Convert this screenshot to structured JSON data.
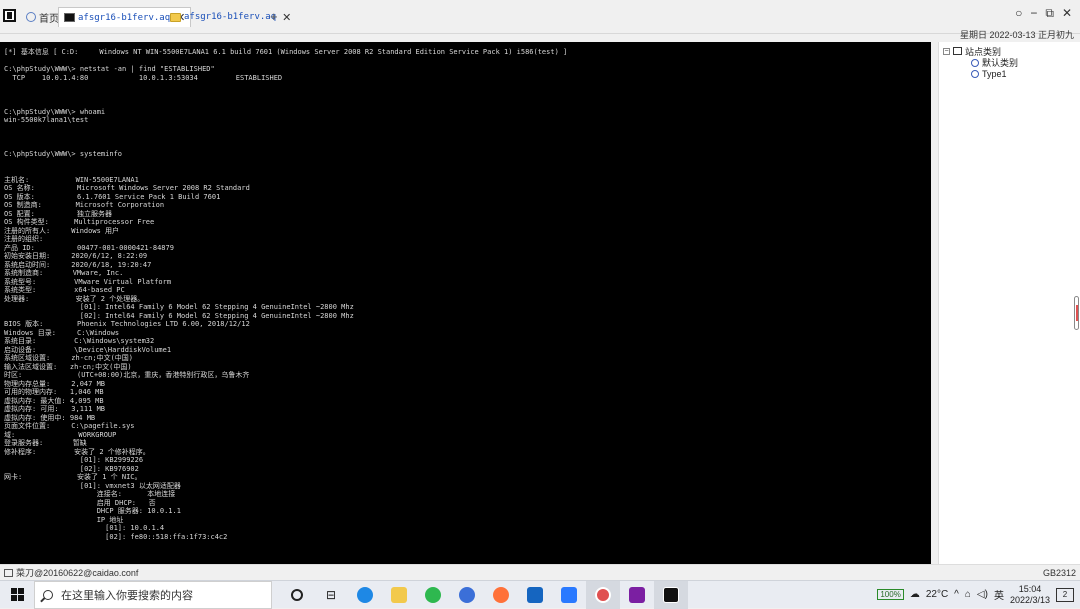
{
  "tabs": [
    {
      "label": "首页",
      "active": false
    },
    {
      "label": "afsgr16-b1ferv.aq",
      "active": true
    },
    {
      "label": "afsgr16-b1ferv.aq",
      "active": false
    }
  ],
  "date_label": "星期日 2022-03-13  正月初九",
  "terminal_lines": [
    "[*] 基本信息 [ C:D:     Windows NT WIN-5500E7LANA1 6.1 build 7601 (Windows Server 2008 R2 Standard Edition Service Pack 1) i586(test) ]",
    "",
    "C:\\phpStudy\\WWW\\> netstat -an | find \"ESTABLISHED\"",
    "  TCP    10.0.1.4:80            10.0.1.3:53034         ESTABLISHED",
    "",
    "",
    "",
    "C:\\phpStudy\\WWW\\> whoami",
    "win-5500k7lana1\\test",
    "",
    "",
    "",
    "C:\\phpStudy\\WWW\\> systeminfo",
    "",
    "",
    "主机名:           WIN-5500E7LANA1",
    "OS 名称:          Microsoft Windows Server 2008 R2 Standard",
    "OS 版本:          6.1.7601 Service Pack 1 Build 7601",
    "OS 制造商:        Microsoft Corporation",
    "OS 配置:          独立服务器",
    "OS 构件类型:      Multiprocessor Free",
    "注册的所有人:     Windows 用户",
    "注册的组织:",
    "产品 ID:          00477-001-0000421-84879",
    "初始安装日期:     2020/6/12, 8:22:09",
    "系统启动时间:     2020/6/18, 19:20:47",
    "系统制造商:       VMware, Inc.",
    "系统型号:         VMware Virtual Platform",
    "系统类型:         x64-based PC",
    "处理器:           安装了 2 个处理器。",
    "                  [01]: Intel64 Family 6 Model 62 Stepping 4 GenuineIntel ~2800 Mhz",
    "                  [02]: Intel64 Family 6 Model 62 Stepping 4 GenuineIntel ~2800 Mhz",
    "BIOS 版本:        Phoenix Technologies LTD 6.00, 2018/12/12",
    "Windows 目录:     C:\\Windows",
    "系统目录:         C:\\Windows\\system32",
    "启动设备:         \\Device\\HarddiskVolume1",
    "系统区域设置:     zh-cn;中文(中国)",
    "输入法区域设置:   zh-cn;中文(中国)",
    "时区:             (UTC+08:00)北京，重庆，香港特别行政区，乌鲁木齐",
    "物理内存总量:     2,047 MB",
    "可用的物理内存:   1,046 MB",
    "虚拟内存: 最大值: 4,095 MB",
    "虚拟内存: 可用:   3,111 MB",
    "虚拟内存: 使用中: 984 MB",
    "页面文件位置:     C:\\pagefile.sys",
    "域:               WORKGROUP",
    "登录服务器:       暂缺",
    "修补程序:         安装了 2 个修补程序。",
    "                  [01]: KB2999226",
    "                  [02]: KB976902",
    "网卡:             安装了 1 个 NIC。",
    "                  [01]: vmxnet3 以太网适配器",
    "                      连接名:      本地连接",
    "                      启用 DHCP:   否",
    "                      DHCP 服务器: 10.0.1.1",
    "                      IP 地址",
    "                        [01]: 10.0.1.4",
    "                        [02]: fe80::518:ffa:1f73:c4c2",
    "",
    "",
    "",
    "",
    "C:\\phpStudy\\WWW\\>"
  ],
  "sidepanel": {
    "root_label": "站点类别",
    "children": [
      "默认类别",
      "Type1"
    ]
  },
  "status": {
    "left": "菜刀@20160622@caidao.conf",
    "right": "GB2312"
  },
  "taskbar": {
    "search_placeholder": "在这里输入你要搜索的内容",
    "battery": "100%",
    "weather": "22°C",
    "ime": "英",
    "time": "15:04",
    "date": "2022/3/13",
    "notifications": "2"
  },
  "colors": {
    "terminal_bg": "#000000",
    "terminal_fg": "#d8d8d8",
    "tab_link": "#1a4fb8"
  }
}
